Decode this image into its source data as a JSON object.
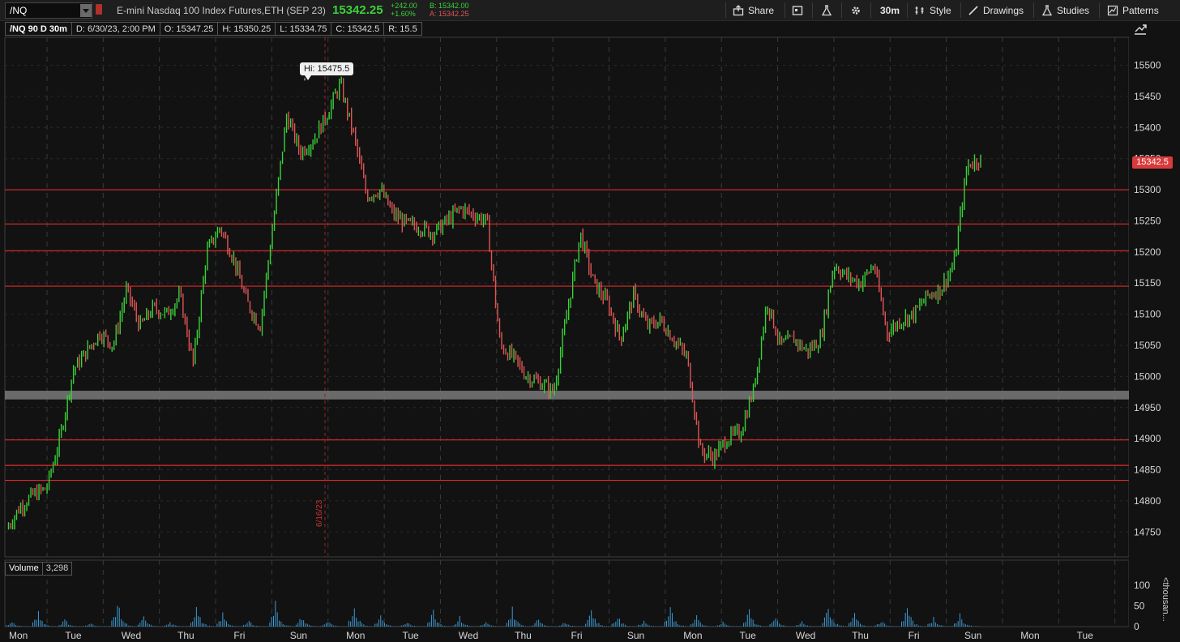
{
  "toolbar": {
    "symbol": "/NQ",
    "description": "E-mini Nasdaq 100 Index Futures,ETH (SEP 23)",
    "last_price": "15342.25",
    "change": "+242.00",
    "change_pct": "+1.60%",
    "bid": "B: 15342.00",
    "ask": "A: 15342.25",
    "share_label": "Share",
    "aggregation_label": "30m",
    "style_label": "Style",
    "drawings_label": "Drawings",
    "studies_label": "Studies",
    "patterns_label": "Patterns",
    "icons": [
      "share-icon",
      "chart-settings-icon",
      "flask-icon",
      "gear-icon",
      "style-icon",
      "drawings-icon",
      "studies-icon",
      "patterns-icon"
    ]
  },
  "info_bar": {
    "title": "/NQ 90 D 30m",
    "date": "D: 6/30/23, 2:00 PM",
    "open": "O: 15347.25",
    "high": "H: 15350.25",
    "low": "L: 15334.75",
    "close": "C: 15342.5",
    "range": "R: 15.5"
  },
  "volume_pane": {
    "label": "Volume",
    "value": "3,298",
    "axis_unit": "<thousan..."
  },
  "colors": {
    "up": "#3ad13a",
    "down": "#e05555",
    "level": "#e02a2a",
    "volume": "#3d9ad6",
    "zone": "#7a7a7a",
    "grid": "#3a3a3a"
  },
  "chart_data": {
    "type": "candlestick",
    "price_ylim": [
      14710,
      15545
    ],
    "price_ticks": [
      14750,
      14800,
      14850,
      14900,
      14950,
      15000,
      15050,
      15100,
      15150,
      15200,
      15250,
      15300,
      15350,
      15400,
      15450,
      15500
    ],
    "volume_ylim": [
      0,
      120
    ],
    "volume_ticks": [
      0,
      50,
      100
    ],
    "x_day_labels": [
      "Mon",
      "Tue",
      "Wed",
      "Thu",
      "Fri",
      "Sun",
      "Mon",
      "Tue",
      "Wed",
      "Thu",
      "Fri",
      "Sun",
      "Mon",
      "Tue",
      "Wed",
      "Thu",
      "Fri",
      "Sun",
      "Mon",
      "Tue"
    ],
    "high_annotation": "Hi: 15475.5",
    "current_price_tag": "15342.5",
    "marker_date_label": "6/16/23",
    "support_resistance_levels": [
      15300,
      15245,
      15202,
      15145,
      14898,
      14857,
      14833
    ],
    "support_zone": [
      14963,
      14977
    ],
    "price_path": [
      [
        0,
        14755
      ],
      [
        0.5,
        14790
      ],
      [
        1,
        14810
      ],
      [
        1.5,
        14820
      ],
      [
        2,
        14900
      ],
      [
        2.5,
        15010
      ],
      [
        3,
        15040
      ],
      [
        3.5,
        15070
      ],
      [
        4,
        15050
      ],
      [
        4.5,
        15140
      ],
      [
        5,
        15080
      ],
      [
        5.5,
        15110
      ],
      [
        6,
        15100
      ],
      [
        6.5,
        15130
      ],
      [
        7,
        15020
      ],
      [
        7.5,
        15200
      ],
      [
        8,
        15240
      ],
      [
        8.5,
        15190
      ],
      [
        9,
        15120
      ],
      [
        9.5,
        15080
      ],
      [
        10,
        15250
      ],
      [
        10.5,
        15420
      ],
      [
        11,
        15360
      ],
      [
        11.5,
        15380
      ],
      [
        12,
        15420
      ],
      [
        12.5,
        15470
      ],
      [
        13,
        15390
      ],
      [
        13.5,
        15290
      ],
      [
        14,
        15300
      ],
      [
        14.5,
        15260
      ],
      [
        15,
        15245
      ],
      [
        15.5,
        15240
      ],
      [
        16,
        15230
      ],
      [
        16.5,
        15250
      ],
      [
        17,
        15270
      ],
      [
        17.5,
        15260
      ],
      [
        18,
        15250
      ],
      [
        18.5,
        15050
      ],
      [
        19,
        15030
      ],
      [
        19.5,
        15000
      ],
      [
        20,
        14990
      ],
      [
        20.5,
        14975
      ],
      [
        21,
        15100
      ],
      [
        21.5,
        15230
      ],
      [
        22,
        15150
      ],
      [
        22.5,
        15120
      ],
      [
        23,
        15060
      ],
      [
        23.5,
        15130
      ],
      [
        24,
        15080
      ],
      [
        24.5,
        15090
      ],
      [
        25,
        15060
      ],
      [
        25.5,
        15030
      ],
      [
        26,
        14880
      ],
      [
        26.5,
        14870
      ],
      [
        27,
        14900
      ],
      [
        27.5,
        14910
      ],
      [
        28,
        14980
      ],
      [
        28.5,
        15120
      ],
      [
        29,
        15050
      ],
      [
        29.5,
        15060
      ],
      [
        30,
        15040
      ],
      [
        30.5,
        15060
      ],
      [
        31,
        15180
      ],
      [
        31.5,
        15160
      ],
      [
        32,
        15150
      ],
      [
        32.5,
        15180
      ],
      [
        33,
        15070
      ],
      [
        33.5,
        15090
      ],
      [
        34,
        15100
      ],
      [
        34.5,
        15130
      ],
      [
        35,
        15140
      ],
      [
        35.5,
        15180
      ],
      [
        36,
        15340
      ],
      [
        36.5,
        15350
      ]
    ],
    "volume_series": [
      12,
      35,
      18,
      8,
      60,
      22,
      10,
      48,
      30,
      14,
      55,
      25,
      12,
      50,
      28,
      11,
      40,
      22,
      10,
      42,
      20,
      12,
      45,
      25,
      14,
      47,
      24,
      11,
      38,
      20,
      12,
      52,
      30,
      15,
      48,
      22,
      30
    ]
  }
}
